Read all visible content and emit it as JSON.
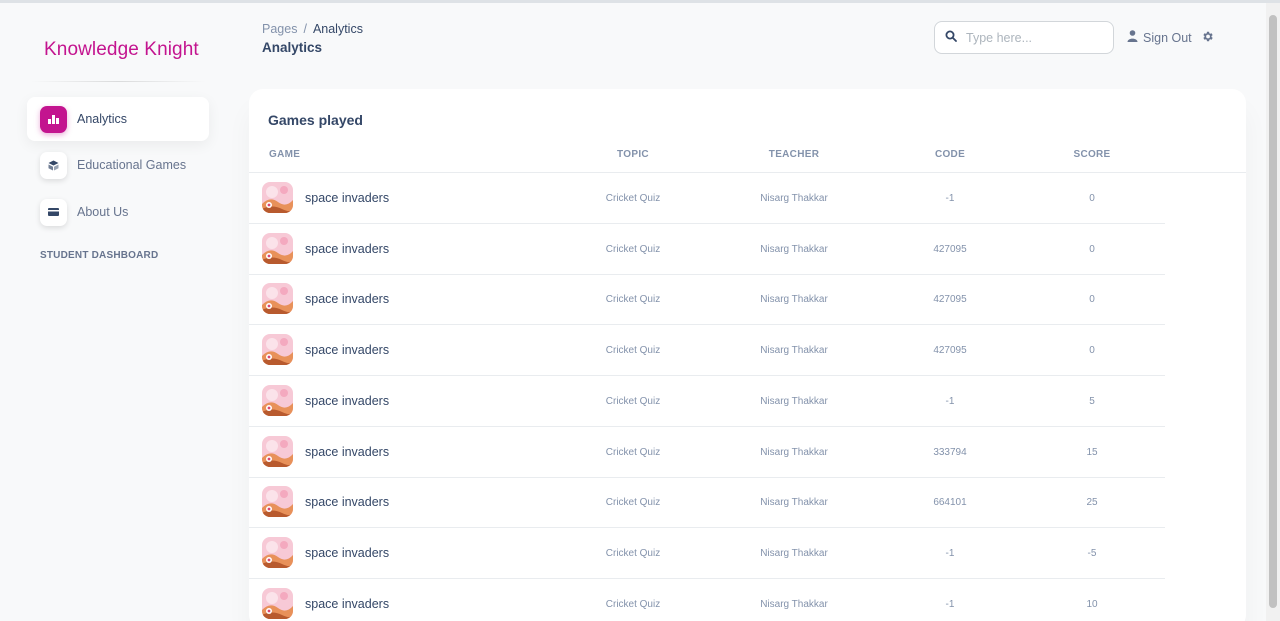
{
  "brand": "Knowledge Knight",
  "sidebar": {
    "items": [
      {
        "label": "Analytics",
        "icon": "chart-icon",
        "active": true
      },
      {
        "label": "Educational Games",
        "icon": "cube-icon",
        "active": false
      },
      {
        "label": "About Us",
        "icon": "card-icon",
        "active": false
      }
    ],
    "section_heading": "STUDENT DASHBOARD"
  },
  "header": {
    "breadcrumb_root": "Pages",
    "breadcrumb_sep": "/",
    "breadcrumb_current": "Analytics",
    "title": "Analytics",
    "search_placeholder": "Type here...",
    "signout_label": "Sign Out"
  },
  "card": {
    "title": "Games played",
    "columns": [
      "GAME",
      "TOPIC",
      "TEACHER",
      "CODE",
      "SCORE"
    ],
    "rows": [
      {
        "game": "space invaders",
        "topic": "Cricket Quiz",
        "teacher": "Nisarg Thakkar",
        "code": "-1",
        "score": "0"
      },
      {
        "game": "space invaders",
        "topic": "Cricket Quiz",
        "teacher": "Nisarg Thakkar",
        "code": "427095",
        "score": "0"
      },
      {
        "game": "space invaders",
        "topic": "Cricket Quiz",
        "teacher": "Nisarg Thakkar",
        "code": "427095",
        "score": "0"
      },
      {
        "game": "space invaders",
        "topic": "Cricket Quiz",
        "teacher": "Nisarg Thakkar",
        "code": "427095",
        "score": "0"
      },
      {
        "game": "space invaders",
        "topic": "Cricket Quiz",
        "teacher": "Nisarg Thakkar",
        "code": "-1",
        "score": "5"
      },
      {
        "game": "space invaders",
        "topic": "Cricket Quiz",
        "teacher": "Nisarg Thakkar",
        "code": "333794",
        "score": "15"
      },
      {
        "game": "space invaders",
        "topic": "Cricket Quiz",
        "teacher": "Nisarg Thakkar",
        "code": "664101",
        "score": "25"
      },
      {
        "game": "space invaders",
        "topic": "Cricket Quiz",
        "teacher": "Nisarg Thakkar",
        "code": "-1",
        "score": "-5"
      },
      {
        "game": "space invaders",
        "topic": "Cricket Quiz",
        "teacher": "Nisarg Thakkar",
        "code": "-1",
        "score": "10"
      }
    ]
  },
  "colors": {
    "accent": "#c3148f",
    "text": "#344767",
    "muted": "#8392ab"
  }
}
